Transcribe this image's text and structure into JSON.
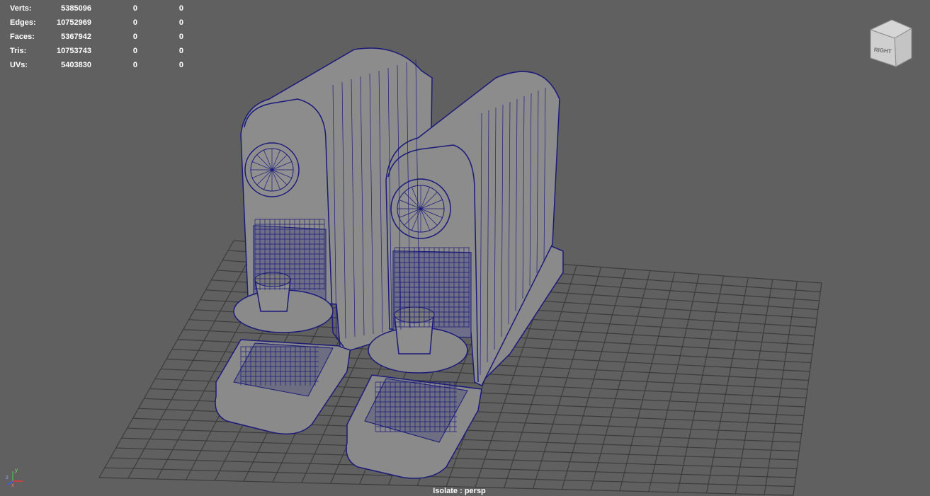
{
  "stats": [
    {
      "label": "Verts:",
      "total": "5385096",
      "selected": "0",
      "component": "0"
    },
    {
      "label": "Edges:",
      "total": "10752969",
      "selected": "0",
      "component": "0"
    },
    {
      "label": "Faces:",
      "total": "5367942",
      "selected": "0",
      "component": "0"
    },
    {
      "label": "Tris:",
      "total": "10753743",
      "selected": "0",
      "component": "0"
    },
    {
      "label": "UVs:",
      "total": "5403830",
      "selected": "0",
      "component": "0"
    }
  ],
  "viewcube": {
    "face_label": "RIGHT"
  },
  "camera_label": "Isolate : persp",
  "axis": {
    "x": "x",
    "y": "y",
    "z": "z"
  },
  "colors": {
    "background": "#606060",
    "grid": "#3c3c3c",
    "wire": "#1a1a7a",
    "shell": "#8a8a8a"
  }
}
